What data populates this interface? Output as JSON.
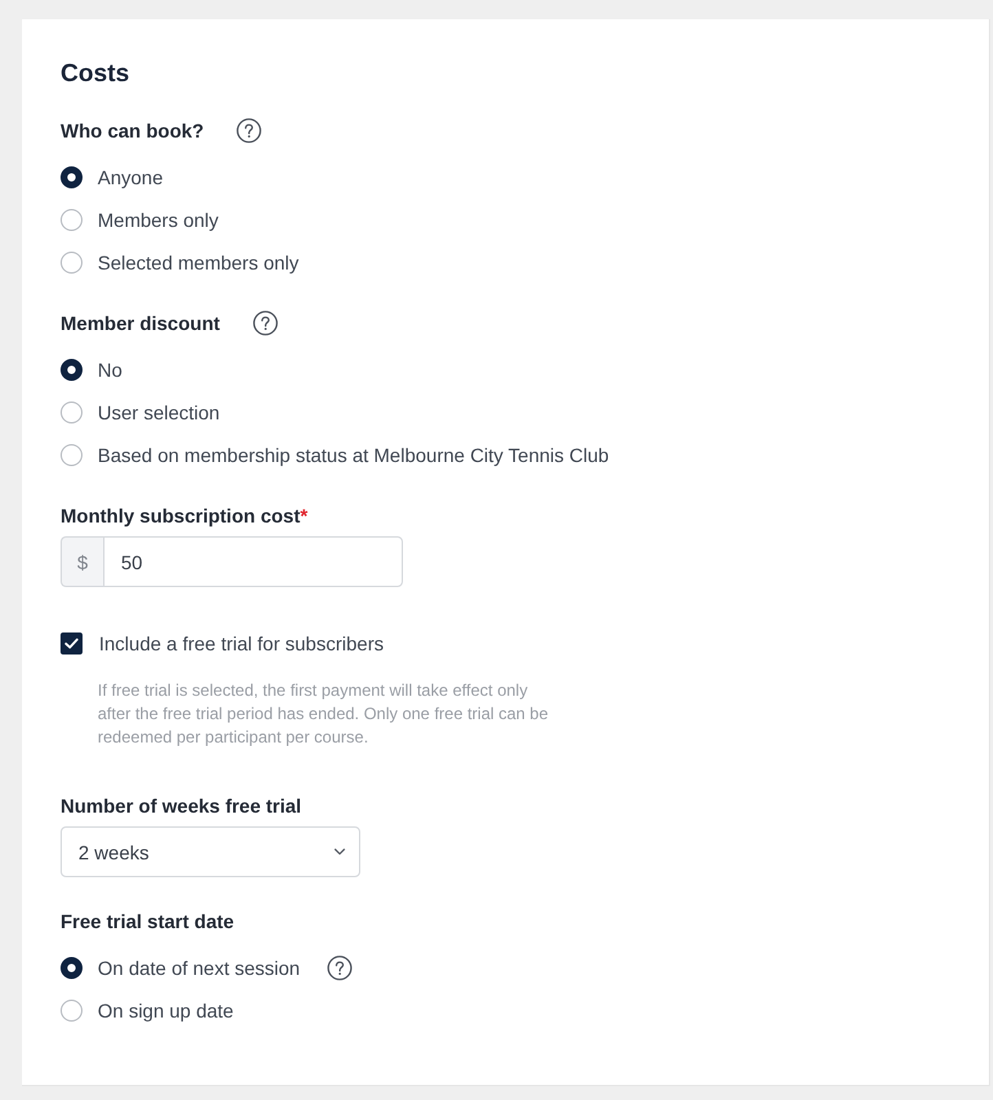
{
  "section": {
    "title": "Costs"
  },
  "fields": [
    {
      "kind": "radio_group",
      "label": "Who can book?",
      "help": true,
      "options": [
        {
          "label": "Anyone",
          "selected": true
        },
        {
          "label": "Members only",
          "selected": false
        },
        {
          "label": "Selected members only",
          "selected": false
        }
      ]
    },
    {
      "kind": "radio_group",
      "label": "Member discount",
      "help": true,
      "options": [
        {
          "label": "No",
          "selected": true
        },
        {
          "label": "User selection",
          "selected": false
        },
        {
          "label": "Based on membership status at Melbourne City Tennis Club",
          "selected": false
        }
      ]
    },
    {
      "kind": "text_input",
      "label": "Monthly subscription cost",
      "required_mark": "*",
      "prefix": "$",
      "value": "50"
    },
    {
      "kind": "checkbox",
      "label": "Include a free trial for subscribers",
      "checked": true,
      "description": "If free trial is selected, the first payment will take effect only after the free trial period has ended. Only one free trial can be redeemed per participant per course."
    },
    {
      "kind": "select",
      "label": "Number of weeks free trial",
      "value": "2 weeks"
    },
    {
      "kind": "radio_group",
      "label": "Free trial start date",
      "options": [
        {
          "label": "On date of next session",
          "selected": true,
          "help": true
        },
        {
          "label": "On sign up date",
          "selected": false,
          "help": false
        }
      ]
    }
  ]
}
